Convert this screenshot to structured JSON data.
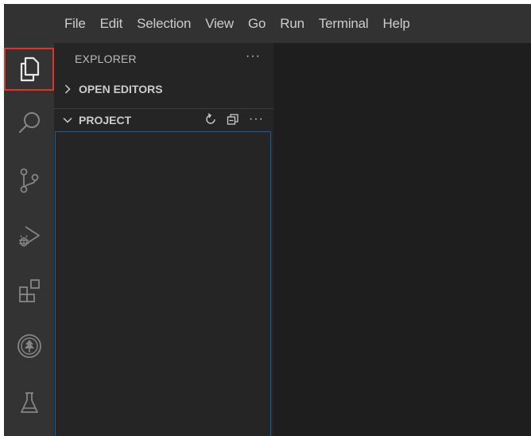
{
  "menu": {
    "items": [
      "File",
      "Edit",
      "Selection",
      "View",
      "Go",
      "Run",
      "Terminal",
      "Help"
    ]
  },
  "activity_bar": {
    "items": [
      {
        "icon": "explorer-icon",
        "active": true
      },
      {
        "icon": "search-icon",
        "active": false
      },
      {
        "icon": "source-control-icon",
        "active": false
      },
      {
        "icon": "run-debug-icon",
        "active": false
      },
      {
        "icon": "extensions-icon",
        "active": false
      },
      {
        "icon": "remote-tree-icon",
        "active": false
      },
      {
        "icon": "testing-flask-icon",
        "active": false
      }
    ],
    "active_outline_color": "#e0332b"
  },
  "sidebar": {
    "title": "EXPLORER",
    "more": "···",
    "sections": {
      "open_editors": {
        "label": "OPEN EDITORS",
        "expanded": false
      },
      "project": {
        "label": "PROJECT",
        "expanded": true,
        "actions_more": "···"
      }
    }
  },
  "colors": {
    "menubar": "#323233",
    "activitybar": "#333333",
    "sidebar": "#252526",
    "editor": "#1e1e1e",
    "focus_border": "#0e639c"
  }
}
